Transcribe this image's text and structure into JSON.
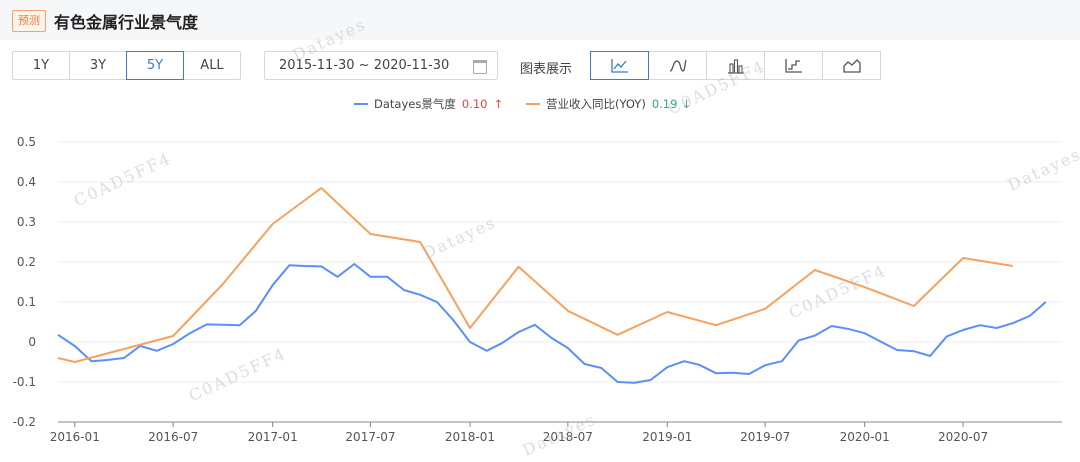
{
  "header": {
    "badge": "预测",
    "title": "有色金属行业景气度"
  },
  "range_buttons": [
    {
      "label": "1Y"
    },
    {
      "label": "3Y"
    },
    {
      "label": "5Y",
      "active": true
    },
    {
      "label": "ALL"
    }
  ],
  "date_range": {
    "text": "2015-11-30 ~ 2020-11-30"
  },
  "chart_types": {
    "label": "图表展示",
    "options": [
      "line-icon",
      "smooth-icon",
      "bar-icon",
      "step-icon",
      "area-icon"
    ],
    "active": "line-icon"
  },
  "legend": [
    {
      "name": "Datayes景气度",
      "value": "0.10",
      "arrow": "↑",
      "color": "#5b8ff9",
      "value_color": "#e8453c"
    },
    {
      "name": "营业收入同比(YOY)",
      "value": "0.19",
      "arrow": "↓",
      "color": "#f6a25e",
      "value_color": "#2fae6b"
    }
  ],
  "watermarks": [
    "Datayes",
    "C0AD5FF4"
  ],
  "chart_data": {
    "type": "line",
    "ylim": [
      -0.2,
      0.5
    ],
    "yticks": [
      0.5,
      0.4,
      0.3,
      0.2,
      0.1,
      0,
      -0.1,
      -0.2
    ],
    "xlim": [
      "2015-12-01",
      "2020-12-31"
    ],
    "xticks": [
      "2016-01",
      "2016-07",
      "2017-01",
      "2017-07",
      "2018-01",
      "2018-07",
      "2019-01",
      "2019-07",
      "2020-01",
      "2020-07"
    ],
    "series": [
      {
        "name": "Datayes景气度",
        "color": "#5b8ff9",
        "points": [
          [
            "2015-12-01",
            0.018
          ],
          [
            "2016-01-01",
            -0.01
          ],
          [
            "2016-02-01",
            -0.048
          ],
          [
            "2016-03-01",
            -0.045
          ],
          [
            "2016-04-01",
            -0.04
          ],
          [
            "2016-05-01",
            -0.01
          ],
          [
            "2016-06-01",
            -0.022
          ],
          [
            "2016-07-01",
            -0.005
          ],
          [
            "2016-08-01",
            0.022
          ],
          [
            "2016-09-01",
            0.044
          ],
          [
            "2016-10-01",
            0.043
          ],
          [
            "2016-11-01",
            0.042
          ],
          [
            "2016-12-01",
            0.078
          ],
          [
            "2017-01-01",
            0.142
          ],
          [
            "2017-02-01",
            0.192
          ],
          [
            "2017-03-01",
            0.19
          ],
          [
            "2017-04-01",
            0.189
          ],
          [
            "2017-05-01",
            0.163
          ],
          [
            "2017-06-01",
            0.195
          ],
          [
            "2017-07-01",
            0.163
          ],
          [
            "2017-08-01",
            0.163
          ],
          [
            "2017-09-01",
            0.13
          ],
          [
            "2017-10-01",
            0.118
          ],
          [
            "2017-11-01",
            0.1
          ],
          [
            "2017-12-01",
            0.055
          ],
          [
            "2018-01-01",
            0.0
          ],
          [
            "2018-02-01",
            -0.022
          ],
          [
            "2018-03-01",
            -0.003
          ],
          [
            "2018-04-01",
            0.025
          ],
          [
            "2018-05-01",
            0.043
          ],
          [
            "2018-06-01",
            0.01
          ],
          [
            "2018-07-01",
            -0.015
          ],
          [
            "2018-08-01",
            -0.055
          ],
          [
            "2018-09-01",
            -0.065
          ],
          [
            "2018-10-01",
            -0.1
          ],
          [
            "2018-11-01",
            -0.102
          ],
          [
            "2018-12-01",
            -0.095
          ],
          [
            "2019-01-01",
            -0.063
          ],
          [
            "2019-02-01",
            -0.048
          ],
          [
            "2019-03-01",
            -0.057
          ],
          [
            "2019-04-01",
            -0.078
          ],
          [
            "2019-05-01",
            -0.077
          ],
          [
            "2019-06-01",
            -0.08
          ],
          [
            "2019-07-01",
            -0.058
          ],
          [
            "2019-08-01",
            -0.048
          ],
          [
            "2019-09-01",
            0.004
          ],
          [
            "2019-10-01",
            0.016
          ],
          [
            "2019-11-01",
            0.04
          ],
          [
            "2019-12-01",
            0.033
          ],
          [
            "2020-01-01",
            0.022
          ],
          [
            "2020-02-01",
            0.0
          ],
          [
            "2020-03-01",
            -0.02
          ],
          [
            "2020-04-01",
            -0.023
          ],
          [
            "2020-05-01",
            -0.035
          ],
          [
            "2020-06-01",
            0.014
          ],
          [
            "2020-07-01",
            0.03
          ],
          [
            "2020-08-01",
            0.042
          ],
          [
            "2020-09-01",
            0.035
          ],
          [
            "2020-10-01",
            0.047
          ],
          [
            "2020-11-01",
            0.065
          ],
          [
            "2020-12-01",
            0.1
          ]
        ]
      },
      {
        "name": "营业收入同比(YOY)",
        "color": "#f6a25e",
        "points": [
          [
            "2015-12-01",
            -0.04
          ],
          [
            "2016-01-01",
            -0.05
          ],
          [
            "2016-07-01",
            0.015
          ],
          [
            "2016-10-01",
            0.145
          ],
          [
            "2017-01-01",
            0.295
          ],
          [
            "2017-04-01",
            0.385
          ],
          [
            "2017-07-01",
            0.27
          ],
          [
            "2017-10-01",
            0.25
          ],
          [
            "2018-01-01",
            0.035
          ],
          [
            "2018-04-01",
            0.188
          ],
          [
            "2018-07-01",
            0.078
          ],
          [
            "2018-10-01",
            0.018
          ],
          [
            "2019-01-01",
            0.075
          ],
          [
            "2019-04-01",
            0.042
          ],
          [
            "2019-07-01",
            0.083
          ],
          [
            "2019-10-01",
            0.18
          ],
          [
            "2020-01-01",
            0.137
          ],
          [
            "2020-04-01",
            0.09
          ],
          [
            "2020-07-01",
            0.21
          ],
          [
            "2020-10-01",
            0.19
          ]
        ]
      }
    ]
  }
}
